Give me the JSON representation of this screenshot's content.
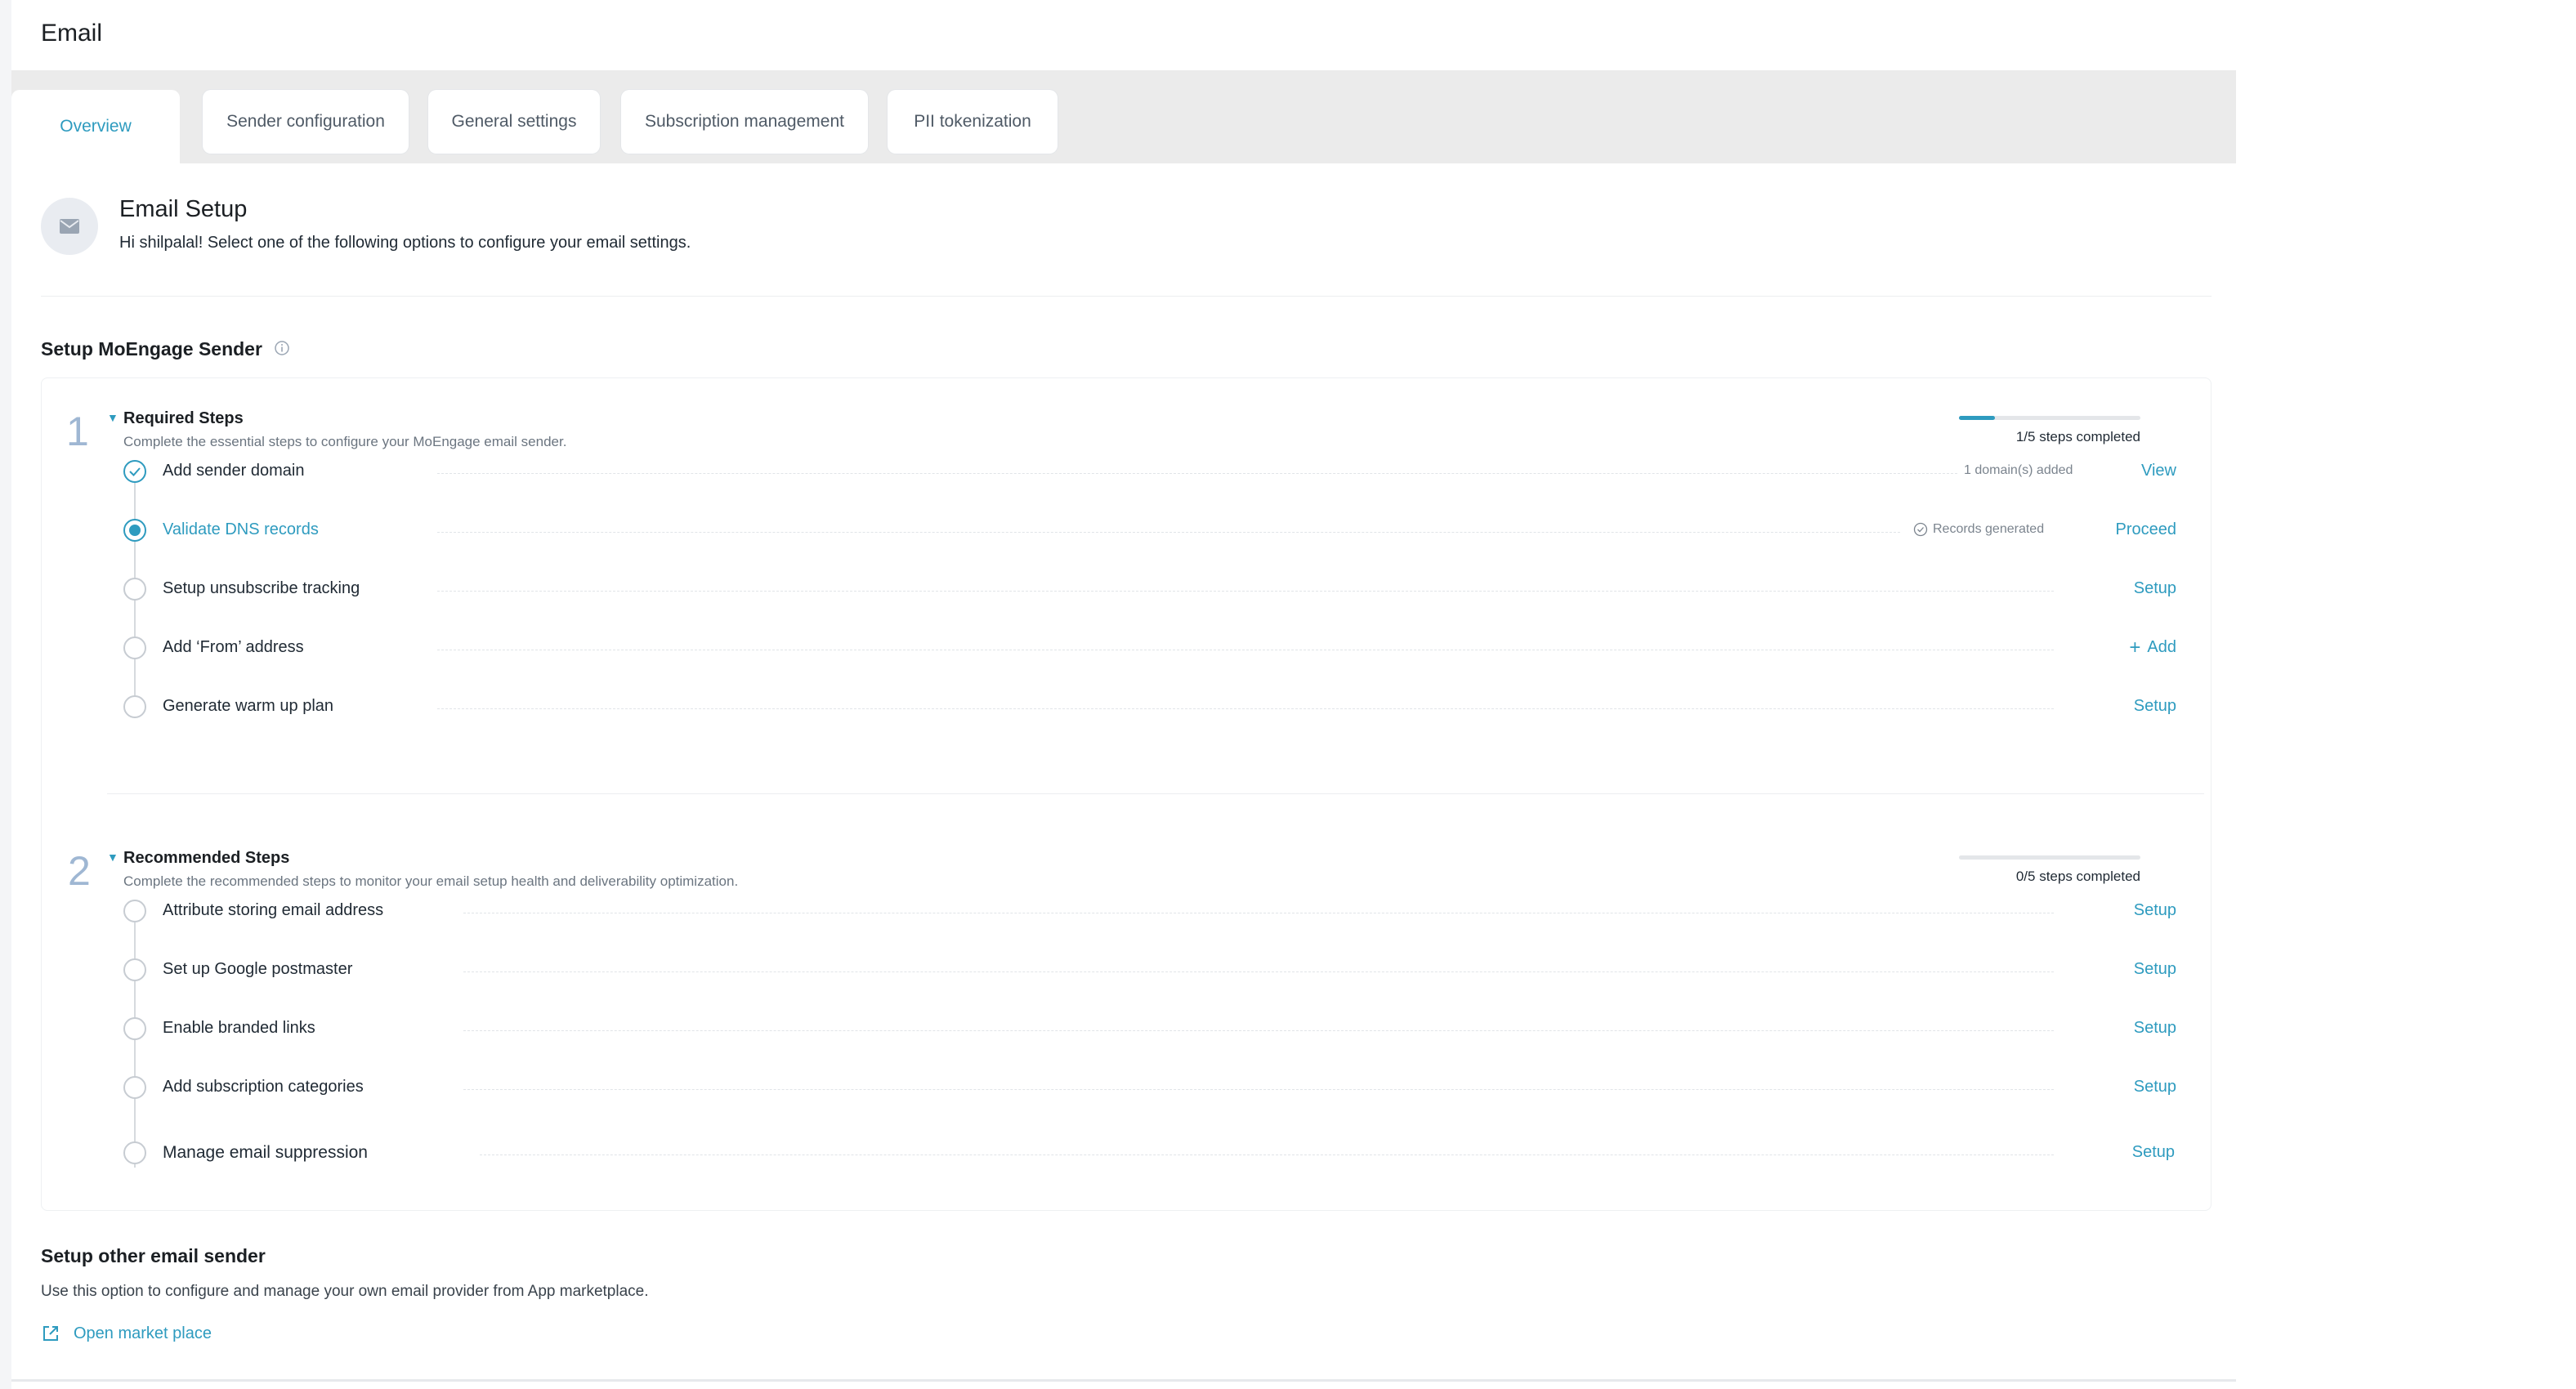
{
  "header": {
    "title": "Email"
  },
  "tabs": [
    {
      "label": "Overview",
      "active": true
    },
    {
      "label": "Sender configuration",
      "active": false
    },
    {
      "label": "General settings",
      "active": false
    },
    {
      "label": "Subscription management",
      "active": false
    },
    {
      "label": "PII tokenization",
      "active": false
    }
  ],
  "intro": {
    "icon": "mail-icon",
    "title": "Email Setup",
    "subtitle": "Hi shilpalal! Select one of the following options to configure your email settings."
  },
  "moengage": {
    "title": "Setup MoEngage Sender",
    "info_icon": "info-icon",
    "groups": [
      {
        "number": "1",
        "title": "Required Steps",
        "description": "Complete the essential steps to configure your MoEngage email sender.",
        "progress_label": "1/5 steps completed",
        "progress_fraction": 0.2,
        "steps": [
          {
            "label": "Add sender domain",
            "state": "done",
            "meta": "1 domain(s) added",
            "action": "View"
          },
          {
            "label": "Validate DNS records",
            "state": "current",
            "meta": "Records generated",
            "action": "Proceed"
          },
          {
            "label": "Setup unsubscribe tracking",
            "state": "pending",
            "meta": "",
            "action": "Setup"
          },
          {
            "label": "Add ‘From’ address",
            "state": "pending",
            "meta": "",
            "action": "Add"
          },
          {
            "label": "Generate warm up plan",
            "state": "pending",
            "meta": "",
            "action": "Setup"
          }
        ]
      },
      {
        "number": "2",
        "title": "Recommended Steps",
        "description": "Complete the recommended steps to monitor your email setup health and deliverability optimization.",
        "progress_label": "0/5 steps completed",
        "progress_fraction": 0,
        "steps": [
          {
            "label": "Attribute storing email address",
            "state": "pending",
            "action": "Setup"
          },
          {
            "label": "Set up Google postmaster",
            "state": "pending",
            "action": "Setup"
          },
          {
            "label": "Enable branded links",
            "state": "pending",
            "action": "Setup"
          },
          {
            "label": "Add subscription categories",
            "state": "pending",
            "action": "Setup"
          },
          {
            "label": "Manage email suppression",
            "state": "pending",
            "action": "Setup"
          }
        ]
      }
    ]
  },
  "other_sender": {
    "title": "Setup other email sender",
    "description": "Use this option to configure and manage your own email provider from App marketplace.",
    "link_label": "Open market place",
    "link_icon": "external-link-icon"
  },
  "colors": {
    "accent": "#2e9bbf",
    "group_number": "#9fb7d3",
    "muted": "#6b7580"
  }
}
